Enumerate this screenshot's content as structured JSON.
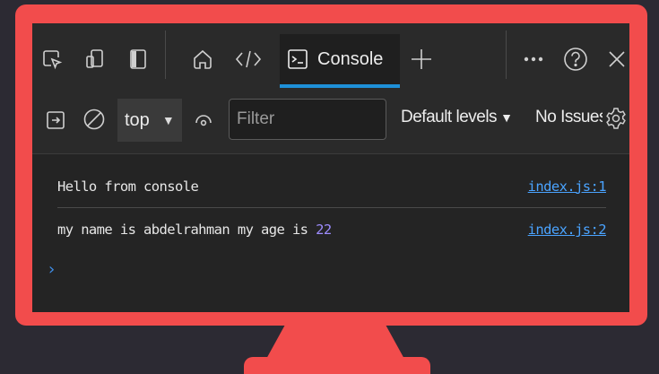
{
  "colors": {
    "background": "#2c2a33",
    "monitor": "#f24c4c",
    "active_tab_underline": "#1e90d8",
    "number": "#9d8cff",
    "link": "#4aa3ff"
  },
  "tabbar": {
    "icons": [
      "inspect-icon",
      "device-emulation-icon",
      "dock-icon",
      "home-icon",
      "elements-code-icon",
      "add-tab-icon",
      "more-icon",
      "help-icon",
      "close-icon"
    ],
    "active_tab": {
      "label": "Console",
      "icon": "console-icon"
    }
  },
  "toolbar": {
    "context": "top",
    "filter_placeholder": "Filter",
    "levels_label": "Default levels",
    "issues_label": "No Issues"
  },
  "console": {
    "messages": [
      {
        "text": "Hello from console",
        "number": "",
        "source": "index.js:1"
      },
      {
        "text": "my name is abdelrahman my age is ",
        "number": "22",
        "source": "index.js:2"
      }
    ],
    "prompt_symbol": "›"
  }
}
